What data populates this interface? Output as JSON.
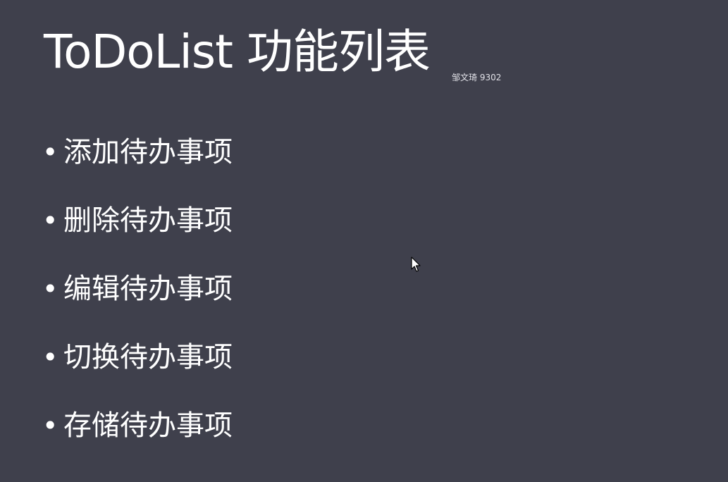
{
  "slide": {
    "title": "ToDoList 功能列表",
    "watermark": "邹文琦 9302",
    "bullets": [
      {
        "label": "添加待办事项"
      },
      {
        "label": "删除待办事项"
      },
      {
        "label": "编辑待办事项"
      },
      {
        "label": "切换待办事项"
      },
      {
        "label": "存储待办事项"
      }
    ],
    "bullet_glyph": "•"
  },
  "colors": {
    "background": "#3f404c",
    "text": "#ffffff"
  },
  "cursor": {
    "icon": "arrow-cursor-icon"
  }
}
